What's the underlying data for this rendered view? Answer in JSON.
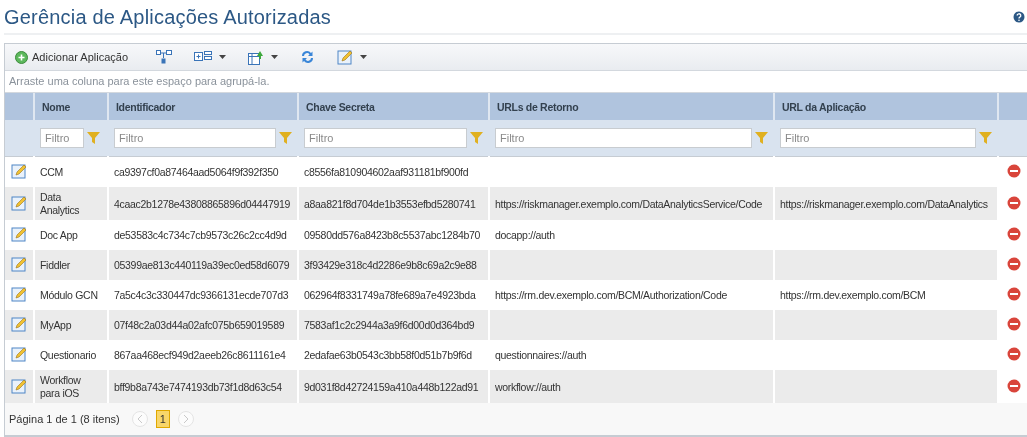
{
  "title": "Gerência de Aplicações Autorizadas",
  "toolbar": {
    "add_label": "Adicionar Aplicação",
    "tools": [
      {
        "kind": "hierarchy",
        "has_menu": false
      },
      {
        "kind": "columns",
        "has_menu": true
      },
      {
        "kind": "export",
        "has_menu": true
      },
      {
        "kind": "refresh",
        "has_menu": false
      },
      {
        "kind": "edit",
        "has_menu": true
      }
    ]
  },
  "group_hint": "Arraste uma coluna para este espaço para agrupá-la.",
  "columns": [
    {
      "label": "Nome",
      "filter_placeholder": "Filtro"
    },
    {
      "label": "Identificador",
      "filter_placeholder": "Filtro"
    },
    {
      "label": "Chave Secreta",
      "filter_placeholder": "Filtro"
    },
    {
      "label": "URLs de Retorno",
      "filter_placeholder": "Filtro"
    },
    {
      "label": "URL da Aplicação",
      "filter_placeholder": "Filtro"
    }
  ],
  "rows": [
    {
      "name": "CCM",
      "id": "ca9397cf0a87464aad5064f9f392f350",
      "secret": "c8556fa810904602aaf931181bf900fd"
    },
    {
      "name": "Data Analytics",
      "id": "4caac2b1278e43808865896d04447919",
      "secret": "a8aa821f8d704de1b3553efbd5280741",
      "return_url": "https://riskmanager.exemplo.com/DataAnalyticsService/Code",
      "app_url": "https://riskmanager.exemplo.com/DataAnalytics"
    },
    {
      "name": "Doc App",
      "id": "de53583c4c734c7cb9573c26c2cc4d9d",
      "secret": "09580dd576a8423b8c5537abc1284b70",
      "return_url": "docapp://auth"
    },
    {
      "name": "Fiddler",
      "id": "05399ae813c440119a39ec0ed58d6079",
      "secret": "3f93429e318c4d2286e9b8c69a2c9e88"
    },
    {
      "name": "Módulo GCN",
      "id": "7a5c4c3c330447dc9366131ecde707d3",
      "secret": "062964f8331749a78fe689a7e4923bda",
      "return_url": "https://rm.dev.exemplo.com/BCM/Authorization/Code",
      "app_url": "https://rm.dev.exemplo.com/BCM"
    },
    {
      "name": "MyApp",
      "id": "07f48c2a03d44a02afc075b659019589",
      "secret": "7583af1c2c2944a3a9f6d00d0d364bd9"
    },
    {
      "name": "Questionario",
      "id": "867aa468ecf949d2aeeb26c8611161e4",
      "secret": "2edafae63b0543c3bb58f0d51b7b9f6d",
      "return_url": "questionnaires://auth"
    },
    {
      "name": "Workflow para iOS",
      "id": "bff9b8a743e7474193db73f1d8d63c54",
      "secret": "9d031f8d42724159a410a448b122ad91",
      "return_url": "workflow://auth"
    }
  ],
  "pager": {
    "summary": "Página 1 de 1 (8 itens)",
    "prev_disabled": true,
    "next_disabled": true,
    "pages": [
      {
        "label": "1",
        "selected": true
      }
    ]
  }
}
